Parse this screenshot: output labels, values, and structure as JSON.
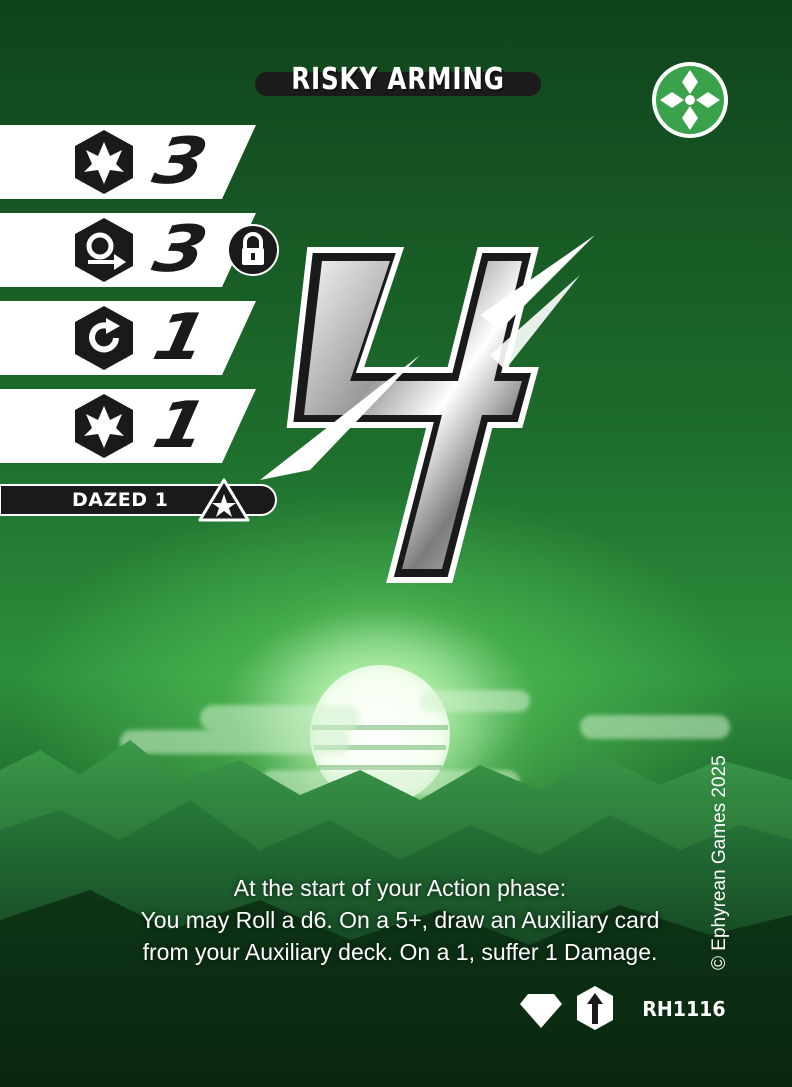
{
  "card": {
    "title": "RISKY ARMING",
    "faction_icon": "faction-emblem-icon",
    "cost_value": "4",
    "stats": [
      {
        "icon": "spiked-burst-icon",
        "value": "3",
        "locked": false
      },
      {
        "icon": "loop-arrow-icon",
        "value": "3",
        "locked": true
      },
      {
        "icon": "refresh-icon",
        "value": "1",
        "locked": false
      },
      {
        "icon": "spiked-burst-icon",
        "value": "1",
        "locked": false
      }
    ],
    "dazed": {
      "label": "DAZED 1",
      "icon": "star-triangle-icon"
    },
    "rules_text": [
      "At the start of your Action phase:",
      "You may Roll a d6. On a 5+, draw an Auxiliary card",
      "from your Auxiliary deck. On a 1, suffer 1 Damage."
    ],
    "copyright": "© Ephyrean Games 2025",
    "footer": {
      "rarity_icon": "diamond-icon",
      "type_icon": "up-arrow-icon",
      "code": "RH1116"
    }
  },
  "colors": {
    "accent_green": "#2f9a3e",
    "band_white": "#ffffff",
    "ink": "#1a1a1a",
    "emblem_green": "#3aa24a"
  }
}
